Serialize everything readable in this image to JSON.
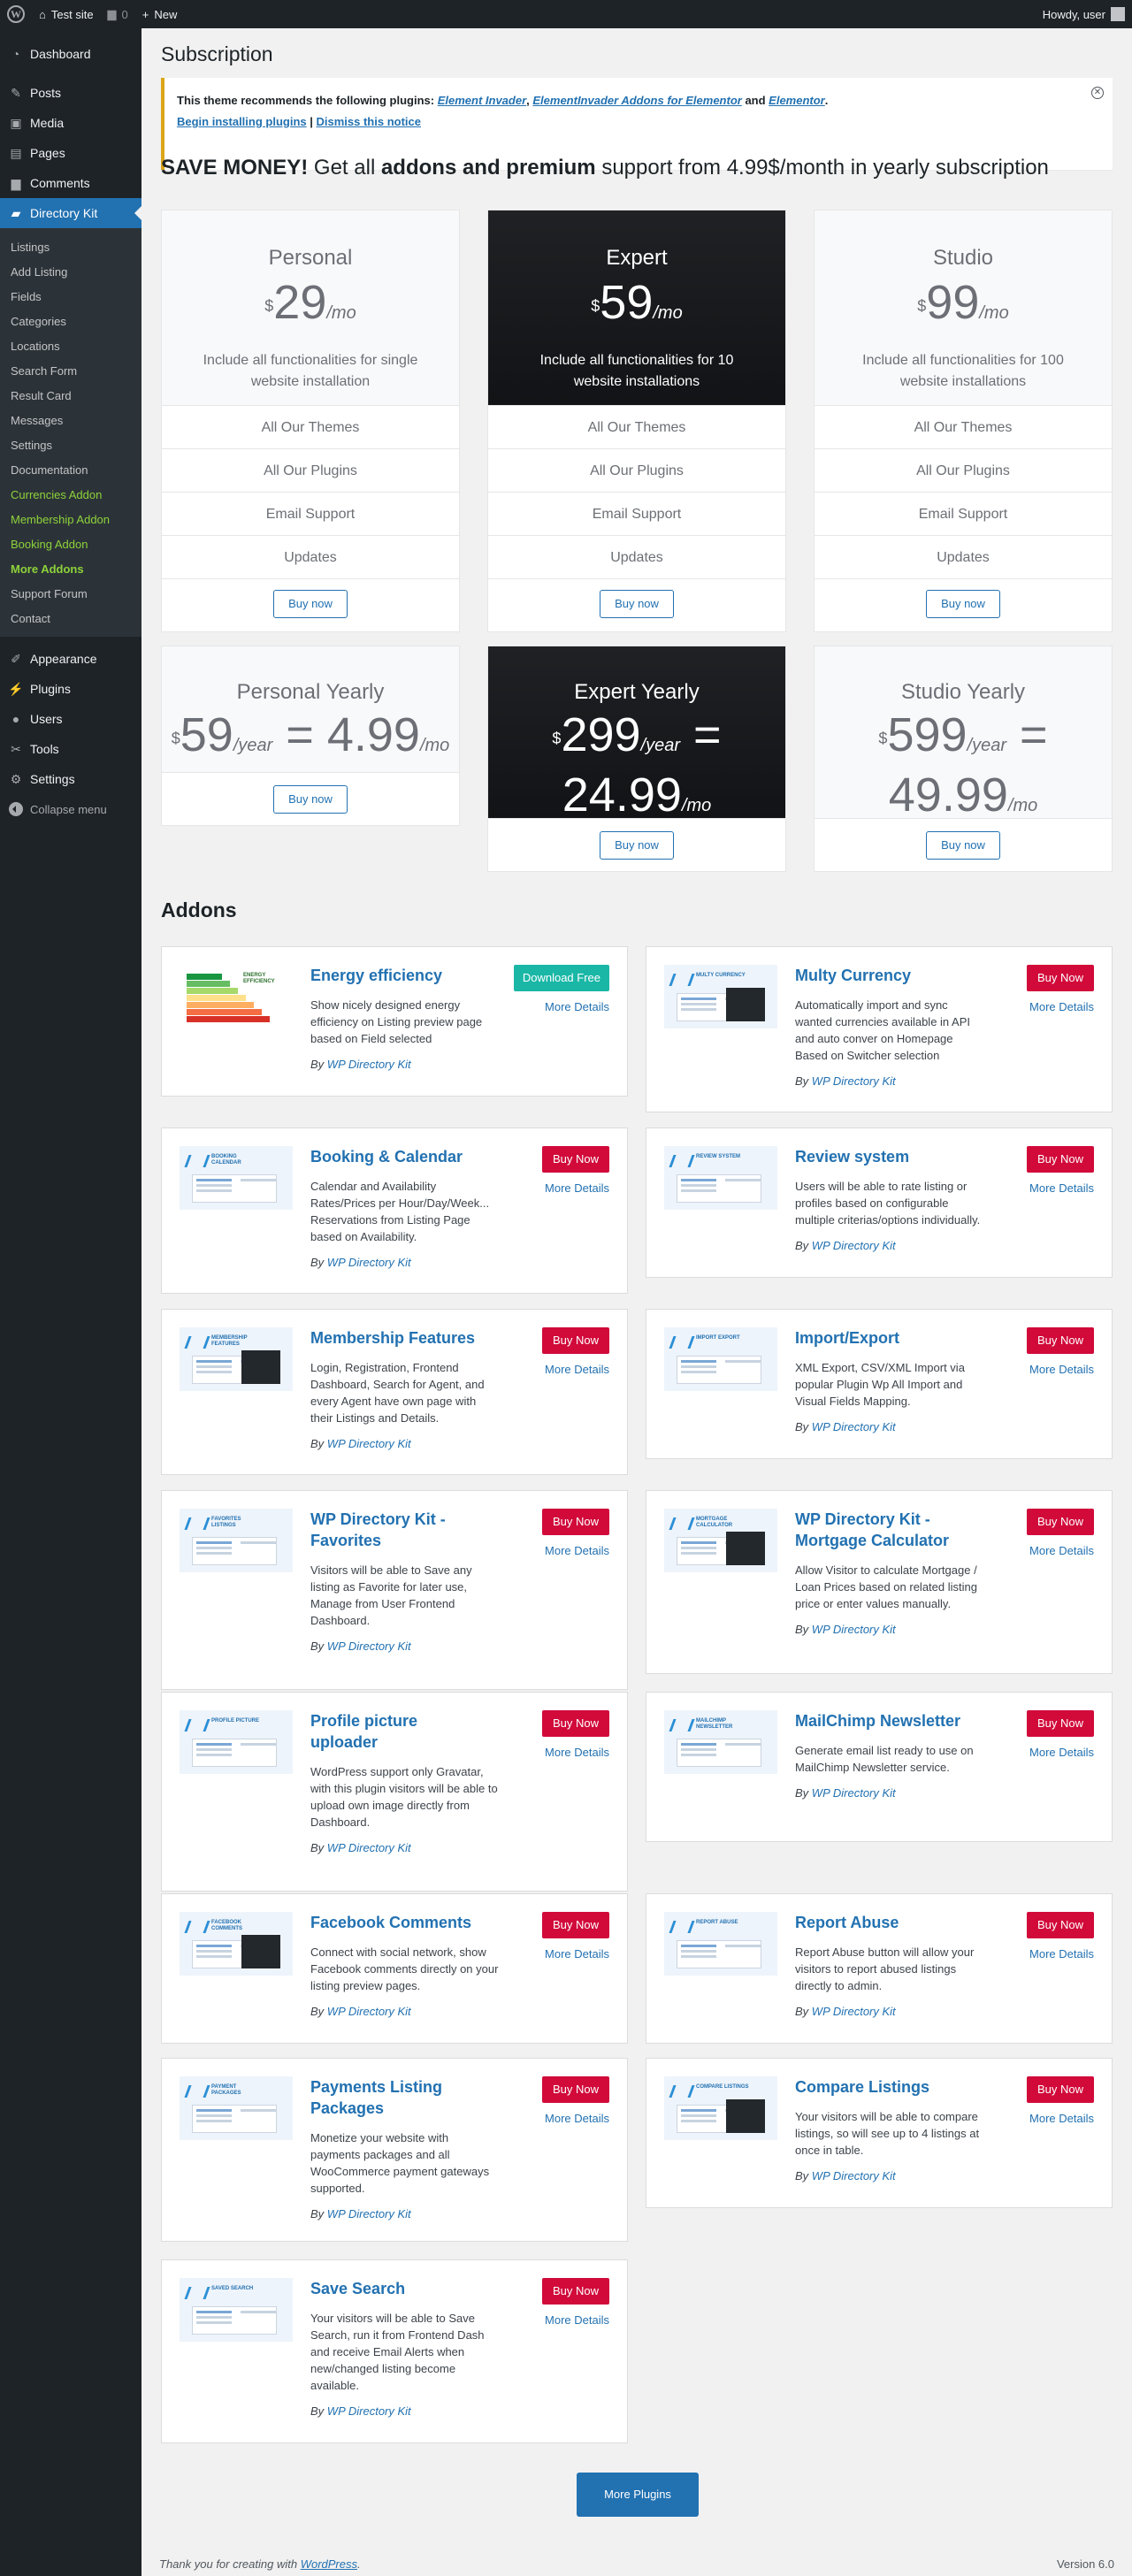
{
  "adminbar": {
    "site_name": "Test site",
    "comments_count": "0",
    "new_label": "New",
    "howdy": "Howdy, user"
  },
  "sidebar": {
    "top_items": [
      {
        "label": "Dashboard",
        "icon": "dashboard-icon"
      }
    ],
    "items": [
      {
        "label": "Posts",
        "icon": "pin-icon"
      },
      {
        "label": "Media",
        "icon": "media-icon"
      },
      {
        "label": "Pages",
        "icon": "pages-icon"
      },
      {
        "label": "Comments",
        "icon": "comment-icon"
      },
      {
        "label": "Directory Kit",
        "icon": "folder-icon"
      }
    ],
    "submenu": [
      "Listings",
      "Add Listing",
      "Fields",
      "Categories",
      "Locations",
      "Search Form",
      "Result Card",
      "Messages",
      "Settings",
      "Documentation",
      "Currencies Addon",
      "Membership Addon",
      "Booking Addon",
      "More Addons",
      "Support Forum",
      "Contact"
    ],
    "bottom_items": [
      {
        "label": "Appearance",
        "icon": "brush-icon"
      },
      {
        "label": "Plugins",
        "icon": "plugin-icon"
      },
      {
        "label": "Users",
        "icon": "users-icon"
      },
      {
        "label": "Tools",
        "icon": "wrench-icon"
      },
      {
        "label": "Settings",
        "icon": "settings-icon"
      }
    ],
    "collapse_label": "Collapse menu"
  },
  "page": {
    "title": "Subscription"
  },
  "notice": {
    "intro": "This theme recommends the following plugins: ",
    "plugin1": "Element Invader",
    "sep1": ", ",
    "plugin2": "ElementInvader Addons for Elementor",
    "sep2": " and ",
    "plugin3": "Elementor",
    "end": ".",
    "begin_link": "Begin installing plugins",
    "divider": " | ",
    "dismiss_link": "Dismiss this notice"
  },
  "promo": {
    "bold1": "SAVE MONEY!",
    "text1": " Get all ",
    "bold2": "addons and premium",
    "text2": " support from 4.99$/month in yearly subscription"
  },
  "plans": [
    {
      "name": "Personal",
      "currency": "$",
      "price": "29",
      "unit": "/mo",
      "desc": "Include all functionalities for single website installation"
    },
    {
      "name": "Expert",
      "currency": "$",
      "price": "59",
      "unit": "/mo",
      "desc": "Include all functionalities for 10 website installations"
    },
    {
      "name": "Studio",
      "currency": "$",
      "price": "99",
      "unit": "/mo",
      "desc": "Include all functionalities for 100 website installations"
    }
  ],
  "features": [
    "All Our Themes",
    "All Our Plugins",
    "Email Support",
    "Updates"
  ],
  "buy_label": "Buy now",
  "yearly": [
    {
      "name": "Personal Yearly",
      "currency": "$",
      "price": "59",
      "unit": "/year",
      "eq": " = ",
      "mprice": "4.99",
      "munit": "/mo"
    },
    {
      "name": "Expert Yearly",
      "currency": "$",
      "price": "299",
      "unit": "/year",
      "eq": " = ",
      "mprice": "24.99",
      "munit": "/mo"
    },
    {
      "name": "Studio Yearly",
      "currency": "$",
      "price": "599",
      "unit": "/year",
      "eq": " = ",
      "mprice": "49.99",
      "munit": "/mo"
    }
  ],
  "addons_title": "Addons",
  "addons": [
    {
      "name": "Energy efficiency",
      "thumb": "Energy efficiency",
      "desc": [
        "Show nicely designed energy",
        "efficiency on Listing preview page",
        "based on Field selected"
      ],
      "action": "Download Free"
    },
    {
      "name": "Multy Currency",
      "thumb": "Multy Currency",
      "desc": [
        "Automatically import and sync",
        "wanted currencies available in API",
        "and auto conver on Homepage",
        "Based on Switcher selection"
      ],
      "action": "Buy Now"
    },
    {
      "name": "Booking & Calendar",
      "thumb": "Booking Calendar",
      "desc": [
        "Calendar and Availability",
        "Rates/Prices per Hour/Day/Week...",
        "Reservations from Listing Page",
        "based on Availability."
      ],
      "action": "Buy Now"
    },
    {
      "name": "Review system",
      "thumb": "Review System",
      "desc": [
        "Users will be able to rate listing or",
        "profiles based on configurable",
        "multiple criterias/options individually."
      ],
      "action": "Buy Now"
    },
    {
      "name": "Membership Features",
      "thumb": "Membership Features",
      "desc": [
        "Login, Registration, Frontend",
        "Dashboard, Search for Agent, and",
        "every Agent have own page with",
        "their Listings and Details."
      ],
      "action": "Buy Now"
    },
    {
      "name": "Import/Export",
      "thumb": "Import Export",
      "desc": [
        "XML Export, CSV/XML Import via",
        "popular Plugin Wp All Import and",
        "Visual Fields Mapping."
      ],
      "action": "Buy Now"
    },
    {
      "name": [
        "WP Directory Kit -",
        "Favorites"
      ],
      "thumb": "Favorites Listings",
      "desc": [
        "Visitors will be able to Save any",
        "listing as Favorite for later use,",
        "Manage from User Frontend",
        "Dashboard."
      ],
      "action": "Buy Now"
    },
    {
      "name": [
        "WP Directory Kit -",
        "Mortgage Calculator"
      ],
      "thumb": "Mortgage Calculator",
      "desc": [
        "Allow Visitor to calculate Mortgage /",
        "Loan Prices based on related listing",
        "price or enter values manually."
      ],
      "action": "Buy Now"
    },
    {
      "name": [
        "Profile picture",
        "uploader"
      ],
      "thumb": "Profile Picture",
      "desc": [
        "WordPress support only Gravatar,",
        "with this plugin visitors will be able to",
        "upload own image directly from",
        "Dashboard."
      ],
      "action": "Buy Now"
    },
    {
      "name": "MailChimp Newsletter",
      "thumb": "MailChimp Newsletter",
      "desc": [
        "Generate email list ready to use on",
        "MailChimp Newsletter service."
      ],
      "action": "Buy Now"
    },
    {
      "name": "Facebook Comments",
      "thumb": "Facebook Comments",
      "desc": [
        "Connect with social network, show",
        "Facebook comments directly on your",
        "listing preview pages."
      ],
      "action": "Buy Now"
    },
    {
      "name": "Report Abuse",
      "thumb": "Report Abuse",
      "desc": [
        "Report Abuse button will allow your",
        "visitors to report abused listings",
        "directly to admin."
      ],
      "action": "Buy Now"
    },
    {
      "name": [
        "Payments Listing",
        "Packages"
      ],
      "thumb": "Payment Packages",
      "desc": [
        "Monetize your website with",
        "payments packages and all",
        "WooCommerce payment gateways",
        "supported."
      ],
      "action": "Buy Now"
    },
    {
      "name": "Compare Listings",
      "thumb": "Compare Listings",
      "desc": [
        "Your visitors will be able to compare",
        "listings, so will see up to 4 listings at",
        "once in table."
      ],
      "action": "Buy Now"
    },
    {
      "name": "Save Search",
      "thumb": "Saved Search",
      "desc": [
        "Your visitors will be able to Save",
        "Search, run it from Frontend Dash",
        "and receive Email Alerts when",
        "new/changed listing become",
        "available."
      ],
      "action": "Buy Now"
    }
  ],
  "more_details": "More Details",
  "by_prefix": "By ",
  "by_author": "WP Directory Kit",
  "more_plugins": "More Plugins",
  "footer": {
    "thanks": "Thank you for creating with ",
    "wp_link": "WordPress",
    "period": ".",
    "version": "Version 6.0"
  },
  "colors": {
    "accent": "#2271b1",
    "buy_now": "#d10a3a",
    "download_free": "#1ab7a6",
    "sidebar_bg": "#1d2327",
    "addon_menu_green": "#8dd33a"
  }
}
